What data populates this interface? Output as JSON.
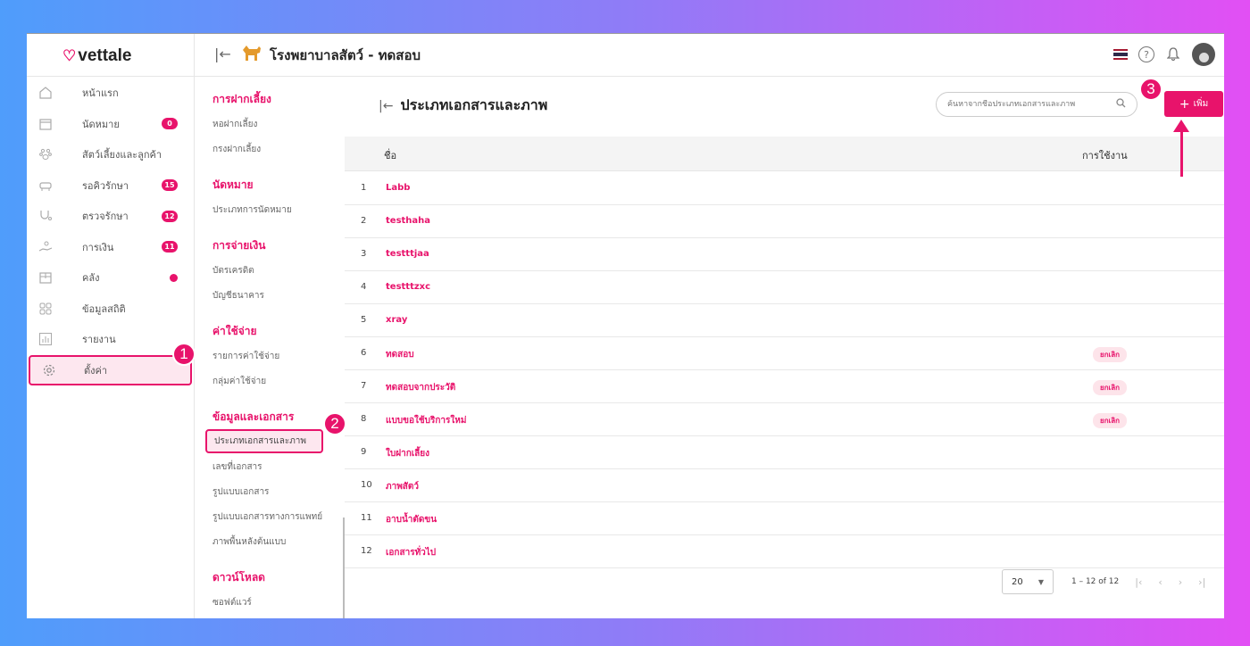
{
  "app": {
    "logo": "vettale",
    "clinic_name": "โรงพยาบาลสัตว์ - ทดสอบ"
  },
  "colors": {
    "accent": "#e8136b",
    "badge_bg": "#fde4ea"
  },
  "sidebar": {
    "items": [
      {
        "label": "หน้าแรก",
        "icon": "home-icon"
      },
      {
        "label": "นัดหมาย",
        "icon": "calendar-icon",
        "badge": "0"
      },
      {
        "label": "สัตว์เลี้ยงและลูกค้า",
        "icon": "paw-icon"
      },
      {
        "label": "รอคิวรักษา",
        "icon": "couch-icon",
        "badge": "15"
      },
      {
        "label": "ตรวจรักษา",
        "icon": "stethoscope-icon",
        "badge": "12"
      },
      {
        "label": "การเงิน",
        "icon": "hand-coin-icon",
        "badge": "11"
      },
      {
        "label": "คลัง",
        "icon": "box-icon",
        "dot": true
      },
      {
        "label": "ข้อมูลสถิติ",
        "icon": "grid-icon"
      },
      {
        "label": "รายงาน",
        "icon": "chart-icon"
      },
      {
        "label": "ตั้งค่า",
        "icon": "gear-icon",
        "active": true
      }
    ]
  },
  "submenu": {
    "groups": [
      {
        "title": "การฝากเลี้ยง",
        "items": [
          "หอฝากเลี้ยง",
          "กรงฝากเลี้ยง"
        ]
      },
      {
        "title": "นัดหมาย",
        "items": [
          "ประเภทการนัดหมาย"
        ]
      },
      {
        "title": "การจ่ายเงิน",
        "items": [
          "บัตรเครดิต",
          "บัญชีธนาคาร"
        ]
      },
      {
        "title": "ค่าใช้จ่าย",
        "items": [
          "รายการค่าใช้จ่าย",
          "กลุ่มค่าใช้จ่าย"
        ]
      },
      {
        "title": "ข้อมูลและเอกสาร",
        "items": [
          "ประเภทเอกสารและภาพ",
          "เลขที่เอกสาร",
          "รูปแบบเอกสาร",
          "รูปแบบเอกสารทางการแพทย์",
          "ภาพพื้นหลังต้นแบบ"
        ]
      },
      {
        "title": "ดาวน์โหลด",
        "items": [
          "ซอฟต์แวร์"
        ]
      }
    ]
  },
  "main": {
    "title": "ประเภทเอกสารและภาพ",
    "search_placeholder": "ค้นหาจากชื่อประเภทเอกสารและภาพ",
    "add_label": "เพิ่ม",
    "columns": {
      "name": "ชื่อ",
      "usage": "การใช้งาน"
    },
    "rows": [
      {
        "num": "1",
        "name": "Labb",
        "usage": ""
      },
      {
        "num": "2",
        "name": "testhaha",
        "usage": ""
      },
      {
        "num": "3",
        "name": "testttjaa",
        "usage": ""
      },
      {
        "num": "4",
        "name": "testttzxc",
        "usage": ""
      },
      {
        "num": "5",
        "name": "xray",
        "usage": ""
      },
      {
        "num": "6",
        "name": "ทดสอบ",
        "usage": "ยกเลิก"
      },
      {
        "num": "7",
        "name": "ทดสอบจากประวัติ",
        "usage": "ยกเลิก"
      },
      {
        "num": "8",
        "name": "แบบขอใช้บริการใหม่",
        "usage": "ยกเลิก"
      },
      {
        "num": "9",
        "name": "ใบฝากเลี้ยง",
        "usage": ""
      },
      {
        "num": "10",
        "name": "ภาพสัตว์",
        "usage": ""
      },
      {
        "num": "11",
        "name": "อาบน้ำตัดขน",
        "usage": ""
      },
      {
        "num": "12",
        "name": "เอกสารทั่วไป",
        "usage": ""
      }
    ],
    "pagination": {
      "per_page": "20",
      "range": "1 – 12 of 12"
    }
  },
  "callouts": [
    "1",
    "2",
    "3"
  ]
}
